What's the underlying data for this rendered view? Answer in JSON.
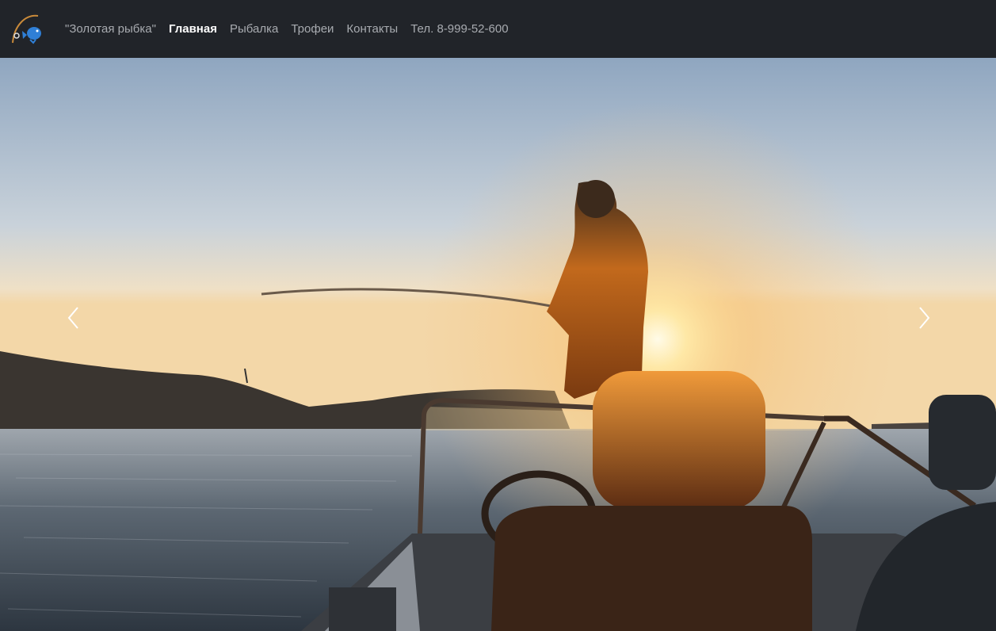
{
  "navbar": {
    "brand": "\"Золотая рыбка\"",
    "links": [
      {
        "label": "Главная",
        "active": true
      },
      {
        "label": "Рыбалка",
        "active": false
      },
      {
        "label": "Трофеи",
        "active": false
      },
      {
        "label": "Контакты",
        "active": false
      }
    ],
    "phone": "Тел. 8-999-52-600",
    "logo_icon": "fishing-rod-fish-icon"
  },
  "carousel": {
    "prev_icon": "chevron-left-icon",
    "next_icon": "chevron-right-icon",
    "slide_image": "fisherman-on-boat-at-sunset"
  },
  "colors": {
    "navbar_bg": "#212429",
    "link": "#a8abb0",
    "link_active": "#ffffff"
  }
}
